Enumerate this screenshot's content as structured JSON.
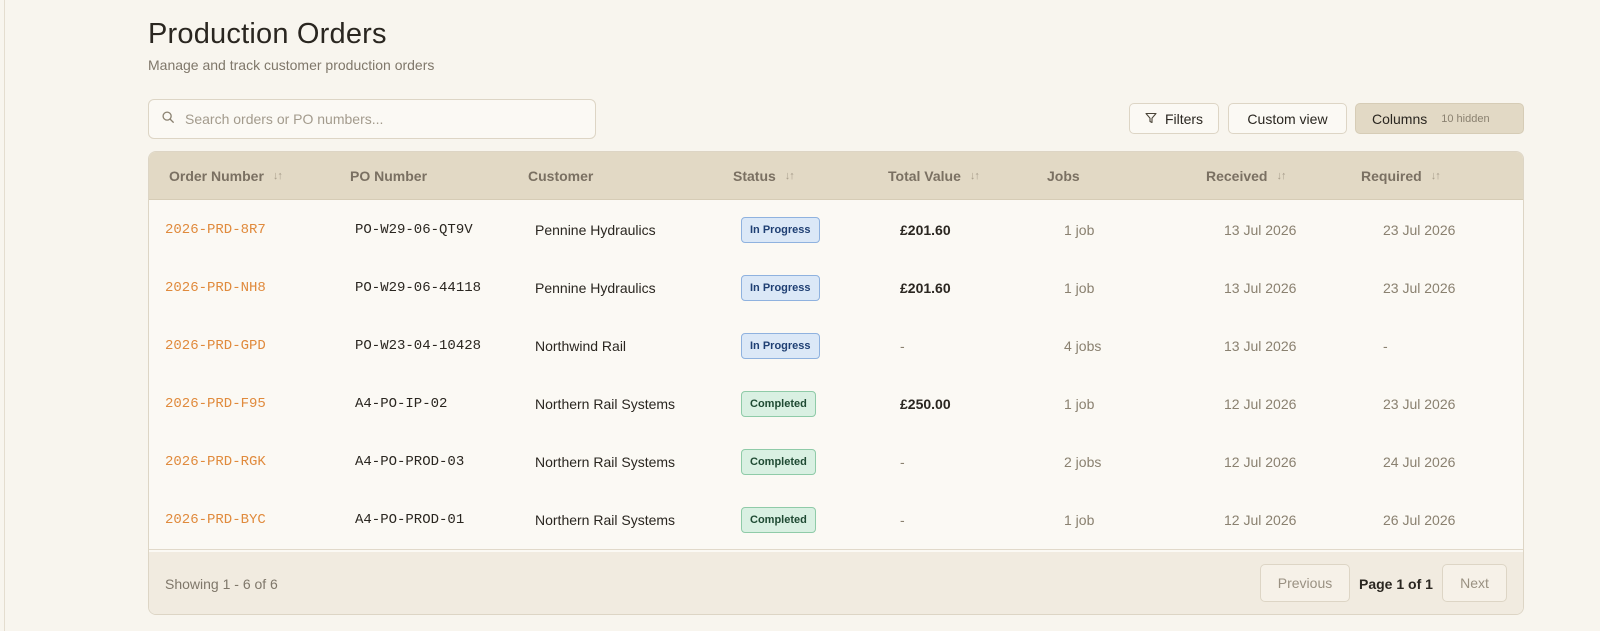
{
  "header": {
    "title": "Production Orders",
    "subtitle": "Manage and track customer production orders"
  },
  "search": {
    "placeholder": "Search orders or PO numbers...",
    "value": ""
  },
  "toolbar": {
    "filters_label": "Filters",
    "custom_view_label": "Custom view",
    "columns_label": "Columns",
    "columns_hidden": "10 hidden"
  },
  "table": {
    "columns": {
      "order": "Order Number",
      "po": "PO Number",
      "customer": "Customer",
      "status": "Status",
      "value": "Total Value",
      "jobs": "Jobs",
      "received": "Received",
      "required": "Required"
    },
    "rows": [
      {
        "order": "2026-PRD-8R7",
        "po": "PO-W29-06-QT9V",
        "customer": "Pennine Hydraulics",
        "status": "In Progress",
        "value": "£201.60",
        "jobs": "1 job",
        "received": "13 Jul 2026",
        "required": "23 Jul 2026"
      },
      {
        "order": "2026-PRD-NH8",
        "po": "PO-W29-06-44118",
        "customer": "Pennine Hydraulics",
        "status": "In Progress",
        "value": "£201.60",
        "jobs": "1 job",
        "received": "13 Jul 2026",
        "required": "23 Jul 2026"
      },
      {
        "order": "2026-PRD-GPD",
        "po": "PO-W23-04-10428",
        "customer": "Northwind Rail",
        "status": "In Progress",
        "value": "-",
        "jobs": "4 jobs",
        "received": "13 Jul 2026",
        "required": "-"
      },
      {
        "order": "2026-PRD-F95",
        "po": "A4-PO-IP-02",
        "customer": "Northern Rail Systems",
        "status": "Completed",
        "value": "£250.00",
        "jobs": "1 job",
        "received": "12 Jul 2026",
        "required": "23 Jul 2026"
      },
      {
        "order": "2026-PRD-RGK",
        "po": "A4-PO-PROD-03",
        "customer": "Northern Rail Systems",
        "status": "Completed",
        "value": "-",
        "jobs": "2 jobs",
        "received": "12 Jul 2026",
        "required": "24 Jul 2026"
      },
      {
        "order": "2026-PRD-BYC",
        "po": "A4-PO-PROD-01",
        "customer": "Northern Rail Systems",
        "status": "Completed",
        "value": "-",
        "jobs": "1 job",
        "received": "12 Jul 2026",
        "required": "26 Jul 2026"
      }
    ]
  },
  "pagination": {
    "showing": "Showing 1 - 6 of 6",
    "previous_label": "Previous",
    "page_label": "Page 1 of 1",
    "next_label": "Next"
  },
  "colors": {
    "accent_order": "#e08a3c",
    "header_bg": "#e2d9c5",
    "status_in_progress": "#dbe8f7",
    "status_completed": "#d9f0e2"
  }
}
